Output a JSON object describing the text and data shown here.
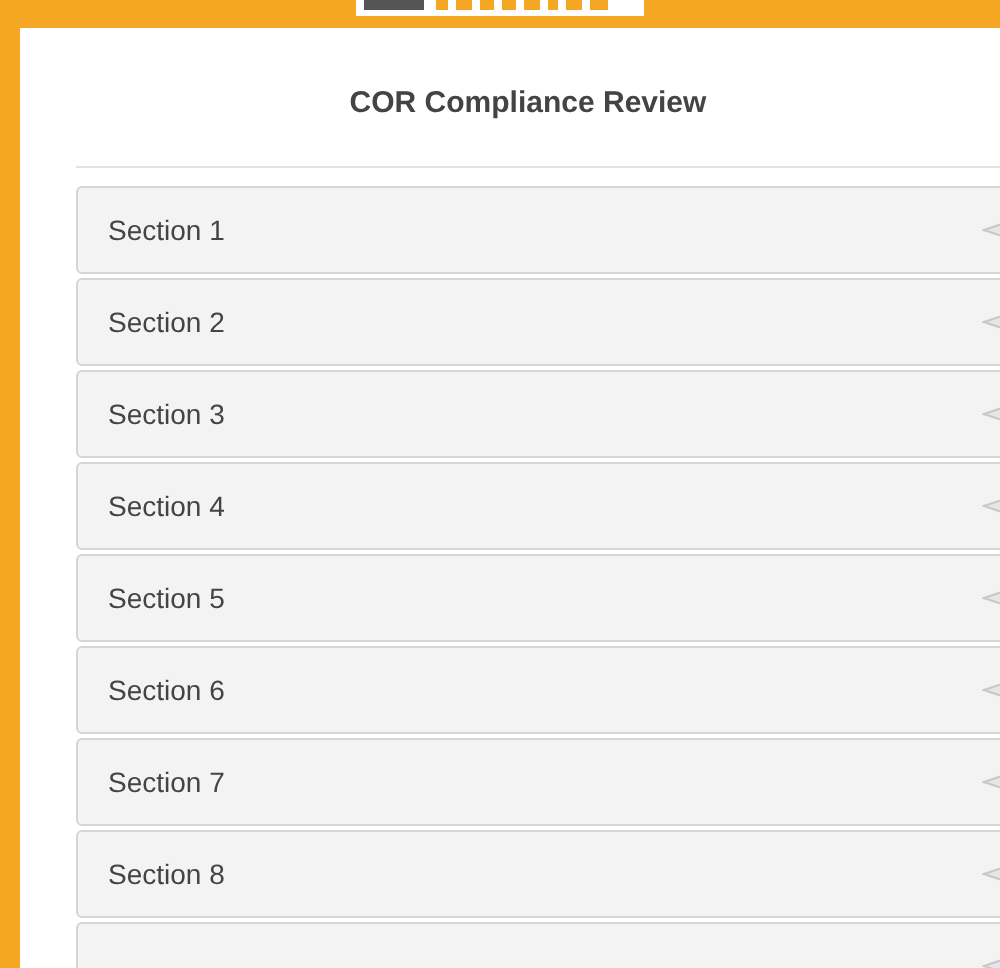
{
  "title": "COR Compliance Review",
  "sections": [
    {
      "label": "Section 1",
      "expanded": false
    },
    {
      "label": "Section 2",
      "expanded": false
    },
    {
      "label": "Section 3",
      "expanded": false
    },
    {
      "label": "Section 4",
      "expanded": false
    },
    {
      "label": "Section 5",
      "expanded": false
    },
    {
      "label": "Section 6",
      "expanded": false
    },
    {
      "label": "Section 7",
      "expanded": false
    },
    {
      "label": "Section 8",
      "expanded": false
    },
    {
      "expanded": false
    }
  ]
}
